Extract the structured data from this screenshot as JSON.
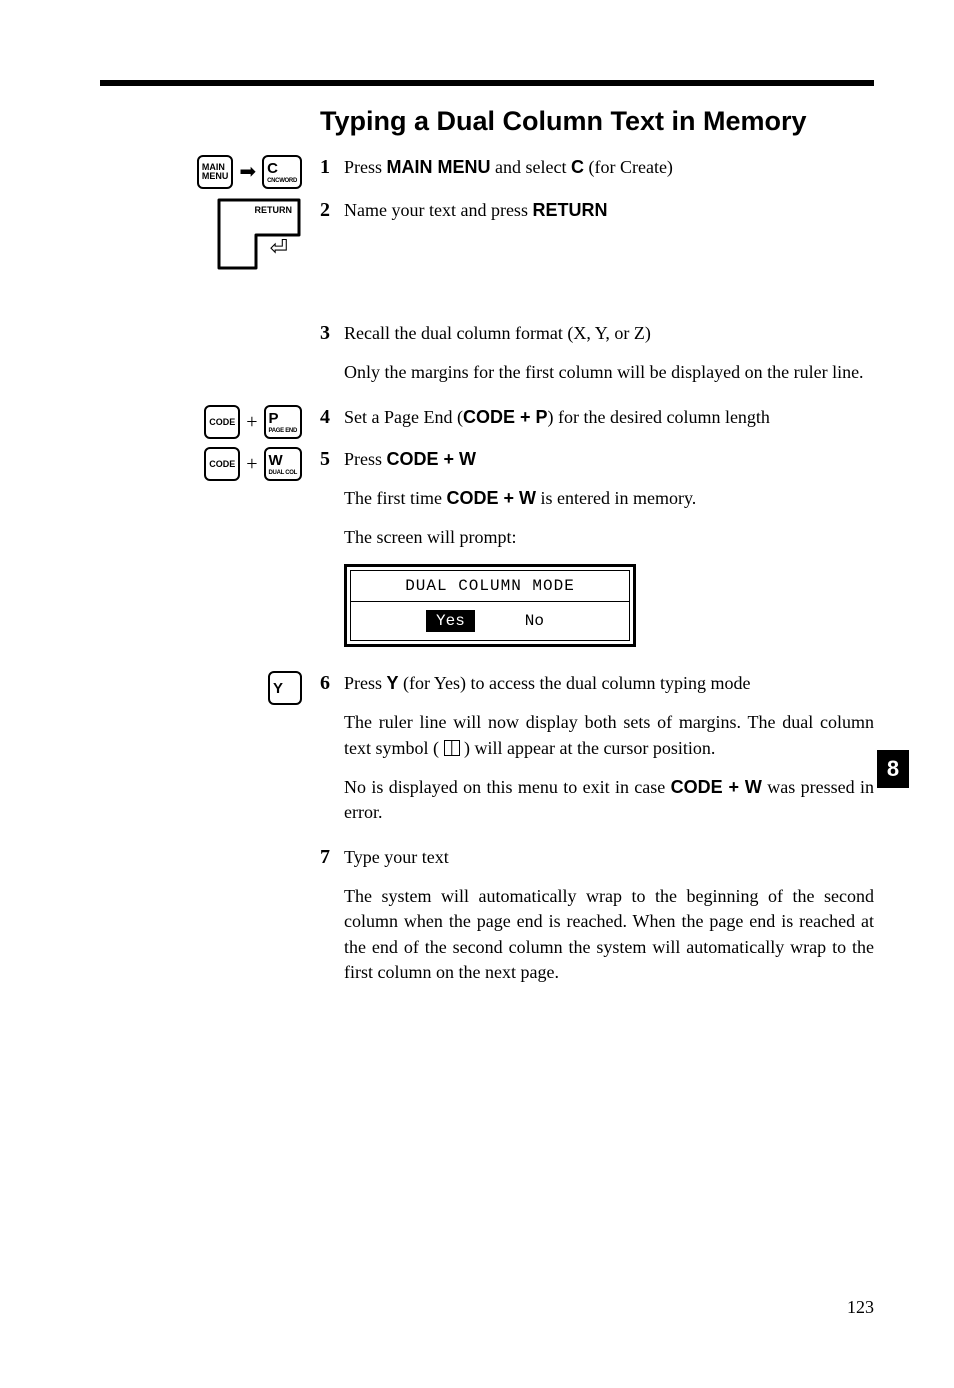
{
  "title": "Typing a Dual Column Text in Memory",
  "keys": {
    "mainmenu": "MAIN\nMENU",
    "c": "C",
    "c_sub": "CNCWORD",
    "return": "RETURN",
    "code": "CODE",
    "p": "P",
    "p_sub": "PAGE END",
    "w": "W",
    "w_sub": "DUAL COL",
    "y": "Y"
  },
  "steps": {
    "s1": {
      "n": "1",
      "a": "Press ",
      "b": "MAIN MENU",
      "c": " and select ",
      "d": "C",
      "e": " (for Create)"
    },
    "s2": {
      "n": "2",
      "a": "Name your text and press ",
      "b": "RETURN"
    },
    "s3": {
      "n": "3",
      "a": "Recall the dual column format (X, Y, or Z)",
      "note": "Only the margins for the first column will be displayed on the ruler line."
    },
    "s4": {
      "n": "4",
      "a": "Set a Page End (",
      "b": "CODE + P",
      "c": ") for the desired column length"
    },
    "s5": {
      "n": "5",
      "a": "Press ",
      "b": "CODE + W",
      "l1a": "The first time ",
      "l1b": "CODE + W",
      "l1c": " is entered in memory.",
      "l2": "The screen will prompt:"
    },
    "s6": {
      "n": "6",
      "a": "Press ",
      "b": "Y",
      "c": " (for Yes) to access the dual column typing mode",
      "p1": "The ruler line will now display both sets of margins. The dual column text symbol ( ",
      "p1b": " ) will appear at the cursor position.",
      "p2a": "No is displayed on this menu to exit in case ",
      "p2b": "CODE + W",
      "p2c": " was pressed in error."
    },
    "s7": {
      "n": "7",
      "a": "Type your text",
      "p1": "The system will automatically wrap to the beginning of the second column when the page end is reached. When the page end is reached at the end of the second column the system will automatically wrap to the first column on the next page."
    }
  },
  "prompt": {
    "title": "DUAL COLUMN MODE",
    "yes": "Yes",
    "no": "No"
  },
  "side_badge": "8",
  "page_number": "123"
}
